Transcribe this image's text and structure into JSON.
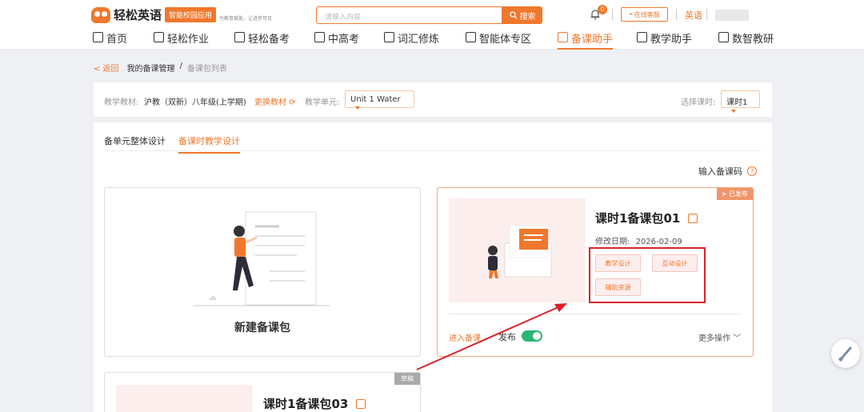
{
  "header": {
    "logo_text": "轻松英语",
    "logo_badge": "智能校园应用",
    "logo_slogan": "为教育赋能，让进步可见",
    "search_placeholder": "请输入内容",
    "search_button": "搜索",
    "notification_count": "0",
    "service_button": "在线客服",
    "language": "英语"
  },
  "nav": [
    {
      "label": "首页"
    },
    {
      "label": "轻松作业"
    },
    {
      "label": "轻松备考"
    },
    {
      "label": "中高考"
    },
    {
      "label": "词汇修炼"
    },
    {
      "label": "智能体专区"
    },
    {
      "label": "备课助手"
    },
    {
      "label": "教学助手"
    },
    {
      "label": "数智教研"
    }
  ],
  "breadcrumb": {
    "back": "< 返回",
    "level1": "我的备课管理",
    "sep": "/",
    "level2": "备课包列表"
  },
  "filters": {
    "textbook_label": "教学教材:",
    "textbook_value": "沪教（双新）八年级(上学期)",
    "change_textbook": "更换教材",
    "unit_label": "教学单元:",
    "unit_value": "Unit 1 Water",
    "lesson_label": "选择课时:",
    "lesson_value": "课时1"
  },
  "tabs": [
    {
      "label": "备单元整体设计"
    },
    {
      "label": "备课时教学设计"
    }
  ],
  "input_code_link": "输入备课码",
  "new_package": {
    "title": "新建备课包"
  },
  "packages": [
    {
      "title": "课时1备课包01",
      "status": "已发布",
      "date_label": "修改日期:",
      "date": "2026-02-09",
      "actions": [
        "教学设计",
        "互动设计",
        "辅助资源"
      ],
      "enter_link": "进入备课",
      "publish_label": "发布",
      "more_ops": "更多操作"
    },
    {
      "title": "课时1备课包03",
      "status": "草稿"
    }
  ],
  "colors": {
    "accent": "#f0782c",
    "annotation_red": "#d9222a",
    "toggle_on": "#2bb673"
  }
}
